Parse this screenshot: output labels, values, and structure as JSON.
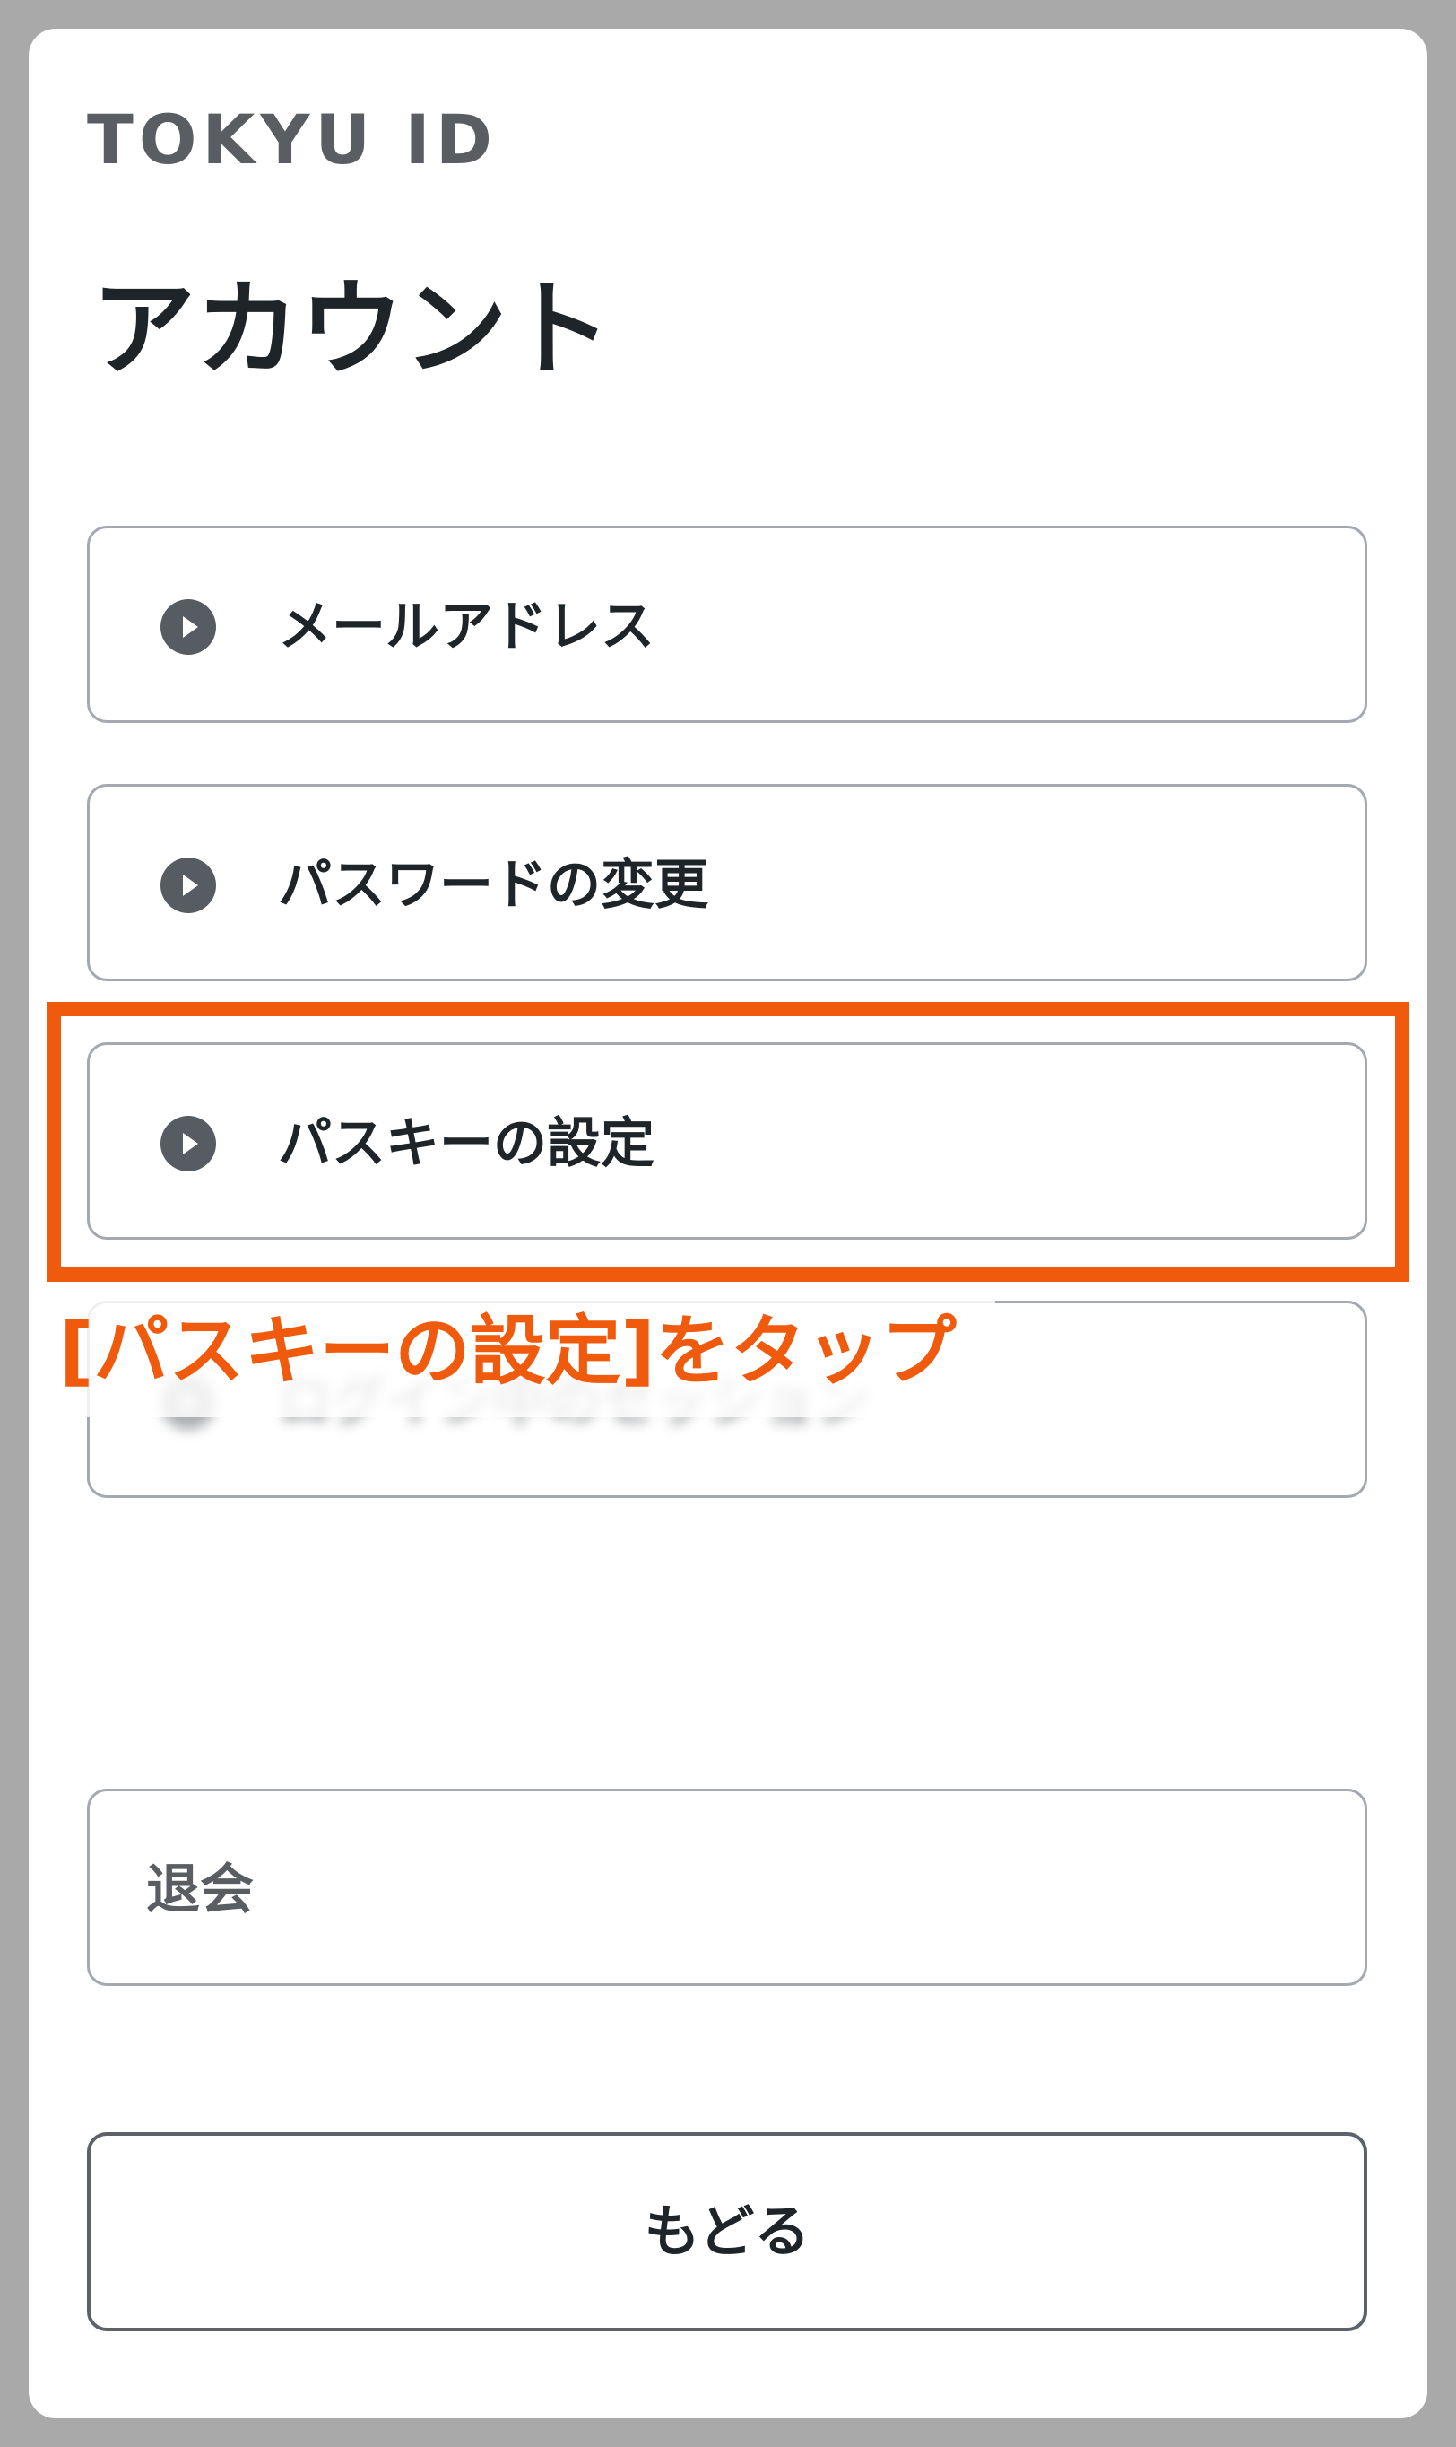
{
  "header": {
    "brand": "TOKYU ID",
    "title": "アカウント"
  },
  "menu": {
    "items": [
      {
        "label": "メールアドレス",
        "icon": "play-circle-icon"
      },
      {
        "label": "パスワードの変更",
        "icon": "play-circle-icon"
      },
      {
        "label": "パスキーの設定",
        "icon": "play-circle-icon"
      },
      {
        "label": "ログイン中のセッション",
        "icon": "play-circle-icon"
      }
    ]
  },
  "annotation": {
    "text": "[パスキーの設定]をタップ",
    "color": "#f05a0c"
  },
  "actions": {
    "withdraw_label": "退会",
    "back_label": "もどる"
  }
}
